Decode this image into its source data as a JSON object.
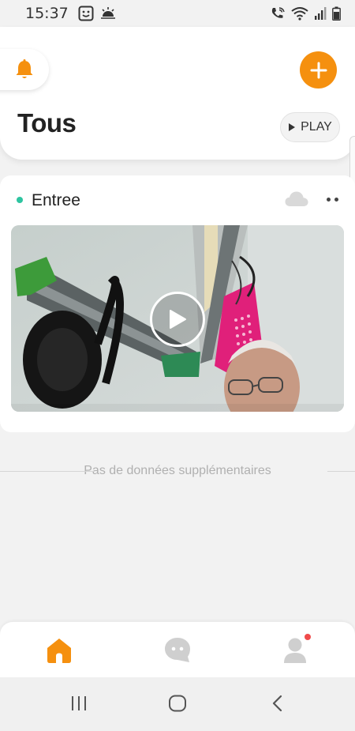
{
  "status_bar": {
    "time": "15:37",
    "left_icons": [
      "smiley-icon",
      "weather-icon"
    ],
    "right_icons": [
      "wifi-call-icon",
      "wifi-icon",
      "signal-icon",
      "battery-icon"
    ]
  },
  "header": {
    "title": "Tous",
    "play_label": "PLAY",
    "bell_icon": "bell-icon",
    "add_icon": "plus-icon"
  },
  "camera": {
    "name": "Entree",
    "status": "online",
    "status_color": "#2ec4a0",
    "cloud_icon": "cloud-icon",
    "more_icon": "more-dots-icon",
    "play_icon": "play-icon"
  },
  "feed": {
    "no_more_text": "Pas de données supplémentaires"
  },
  "bottom_nav": {
    "items": [
      "home",
      "chat",
      "profile"
    ],
    "active": "home",
    "profile_badge": true
  },
  "colors": {
    "accent": "#f5900f",
    "badge": "#f04b4b",
    "inactive_icon": "#cfcfcf"
  }
}
